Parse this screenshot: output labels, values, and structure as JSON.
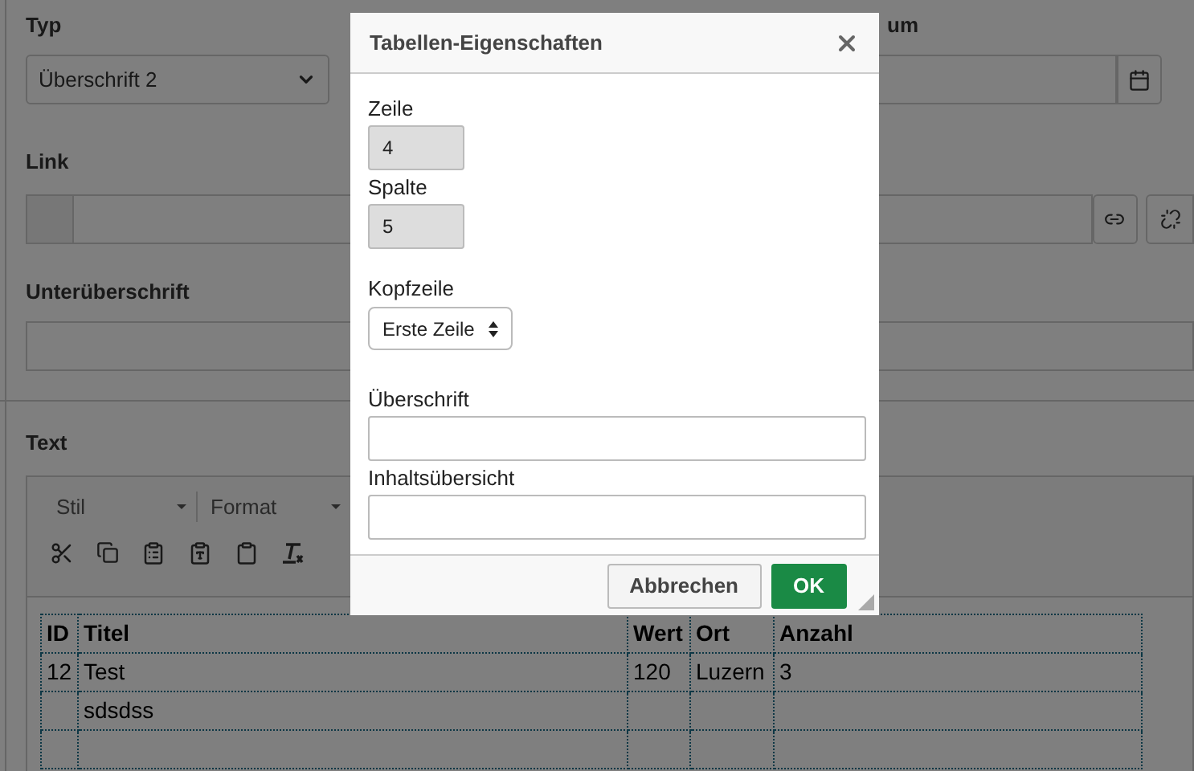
{
  "form": {
    "typ": {
      "label": "Typ",
      "value": "Überschrift 2"
    },
    "datum": {
      "label_fragment": "um"
    },
    "link": {
      "label": "Link"
    },
    "subtitle": {
      "label": "Unterüberschrift"
    },
    "text": {
      "label": "Text"
    }
  },
  "editor": {
    "dropdowns": [
      "Stil",
      "Format"
    ],
    "table": {
      "columns": [
        "ID",
        "Titel",
        "Wert",
        "Ort",
        "Anzahl"
      ],
      "rows": [
        [
          "12",
          "Test",
          "120",
          "Luzern",
          "3"
        ],
        [
          null,
          "sdsdss",
          null,
          null,
          null
        ],
        [
          null,
          null,
          null,
          null,
          null
        ]
      ]
    }
  },
  "dialog": {
    "title": "Tabellen-Eigenschaften",
    "rows": {
      "label": "Zeile",
      "value": "4"
    },
    "columns": {
      "label": "Spalte",
      "value": "5"
    },
    "header": {
      "label": "Kopfzeile",
      "value": "Erste Zeile"
    },
    "caption": {
      "label": "Überschrift"
    },
    "summary": {
      "label": "Inhaltsübersicht"
    },
    "buttons": [
      {
        "label": "Abbrechen",
        "kind": "secondary"
      },
      {
        "label": "OK",
        "kind": "primary"
      }
    ]
  }
}
